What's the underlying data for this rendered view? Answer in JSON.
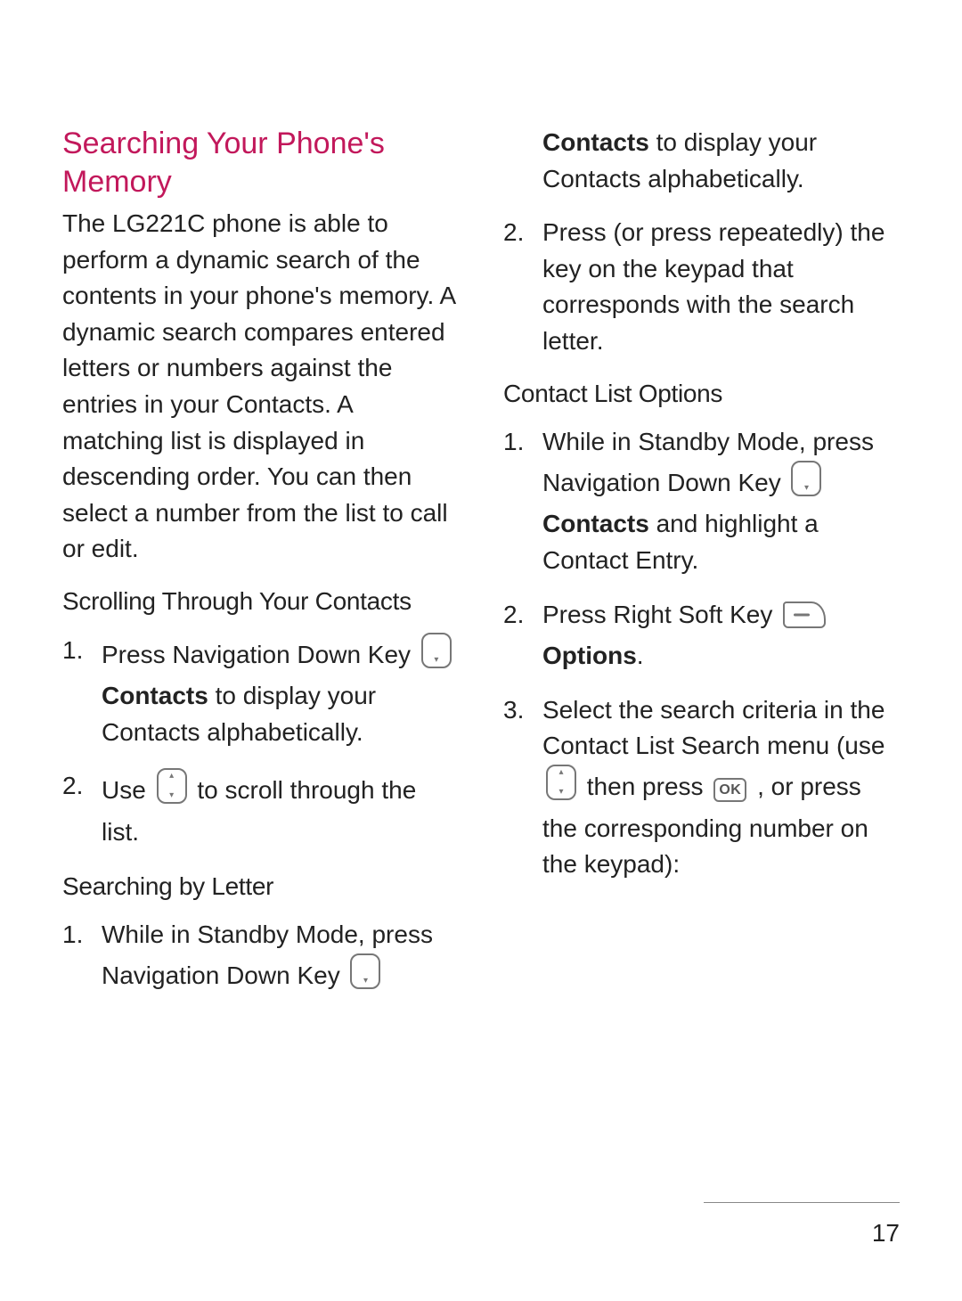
{
  "page_number": "17",
  "title": "Searching Your Phone's Memory",
  "intro": "The LG221C phone is able to perform a dynamic search of the contents in your phone's memory. A dynamic search compares entered letters or numbers against the entries in your Contacts. A matching list is displayed in descending order. You can then select a number from the list to call or edit.",
  "sub1": "Scrolling Through Your Contacts",
  "scroll_steps": {
    "s1_a": "Press Navigation Down Key ",
    "s1_b_bold": "Contacts",
    "s1_c": " to display your Contacts alphabetically.",
    "s2_a": "Use ",
    "s2_b": " to scroll through the list."
  },
  "sub2": "Searching by Letter",
  "letter_steps": {
    "s1": "While in Standby Mode, press Navigation Down Key ",
    "s1_cont_bold": "Contacts",
    "s1_cont_rest": " to display your Contacts alphabetically.",
    "s2": "Press (or press repeatedly) the key on the keypad that corresponds with the search letter."
  },
  "sub3": "Contact List Options",
  "options_steps": {
    "s1_a": "While in Standby Mode, press Navigation Down Key ",
    "s1_bold": "Contacts",
    "s1_c": " and highlight a Contact Entry.",
    "s2_a": "Press Right Soft Key ",
    "s2_bold": "Options",
    "s2_c": ".",
    "s3_a": "Select the search criteria in the Contact List Search menu (use ",
    "s3_b": " then press ",
    "s3_c": ", or press the corresponding number on the keypad):"
  },
  "icons": {
    "nav_down": "nav-down-key-icon",
    "nav_updown": "nav-updown-key-icon",
    "soft_right": "right-soft-key-icon",
    "ok": "ok-key-icon",
    "ok_label": "OK"
  }
}
